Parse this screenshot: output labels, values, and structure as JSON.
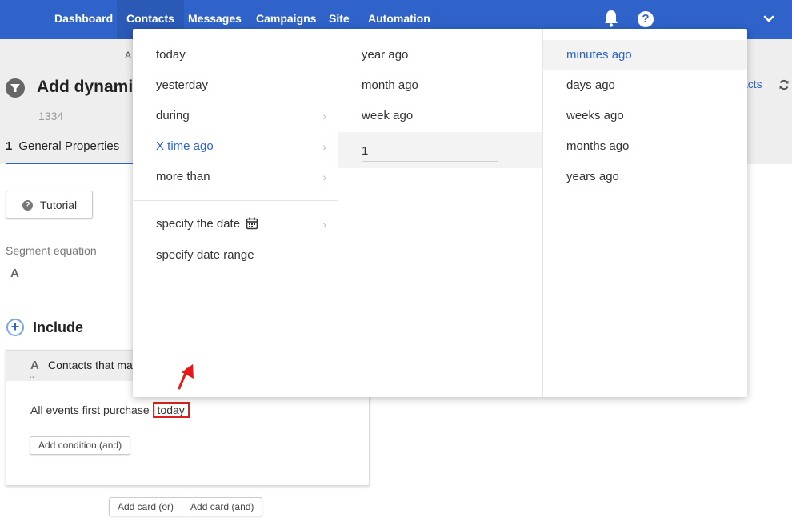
{
  "nav": {
    "items": [
      "Dashboard",
      "Contacts",
      "Messages",
      "Campaigns",
      "Site",
      "Automation"
    ],
    "active": "Contacts",
    "help_label": "?"
  },
  "header": {
    "breadcrumb": "A",
    "title": "Add dynamic",
    "id": "1334",
    "contacts_link": "acts",
    "step_number": "1",
    "step_label": "General Properties"
  },
  "body": {
    "tutorial_label": "Tutorial",
    "tutorial_icon": "?",
    "segment_label": "Segment equation",
    "segment_value": "A",
    "include_icon": "+",
    "include_label": "Include",
    "card": {
      "letter": "A",
      "drag_handle": "▪▪",
      "title": "Contacts that ma",
      "condition_prefix": "All events  first purchase",
      "condition_value": "today",
      "add_condition": "Add condition (and)"
    },
    "add_card_or": "Add card (or)",
    "add_card_and": "Add card (and)"
  },
  "dropdown": {
    "col1": [
      "today",
      "yesterday",
      "during",
      "X time ago",
      "more than"
    ],
    "col1_extra": [
      "specify the date",
      "specify date range"
    ],
    "col1_active": "X time ago",
    "col2": [
      "year ago",
      "month ago",
      "week ago"
    ],
    "col2_input_value": "1",
    "col3": [
      "minutes ago",
      "days ago",
      "weeks ago",
      "months ago",
      "years ago"
    ],
    "col3_active": "minutes ago",
    "submenu_arrow": "›"
  },
  "colors": {
    "nav_bg": "#2f63c9",
    "accent": "#2f63c9",
    "highlight_border": "#d9221f",
    "arrow": "#e8191a"
  }
}
